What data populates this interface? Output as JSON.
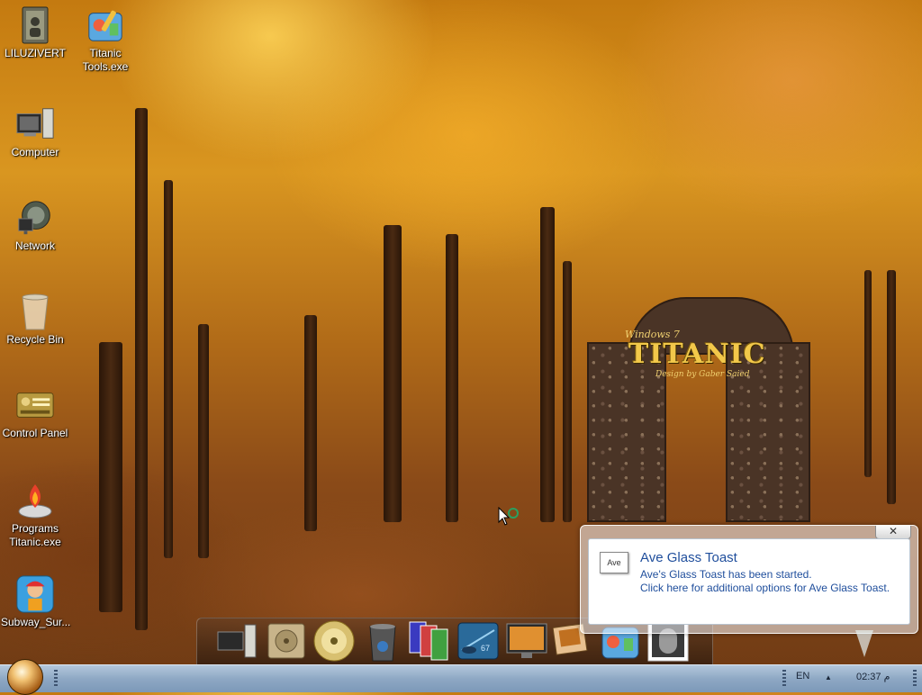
{
  "wallpaper": {
    "logo_small": "Windows 7",
    "logo_big": "TITANIC",
    "logo_sub": "Design by Gaber Saied"
  },
  "desktop_icons": [
    {
      "label": "LILUZIVERT",
      "icon": "user-folder-icon"
    },
    {
      "label": "Titanic\nTools.exe",
      "icon": "tools-icon"
    },
    {
      "label": "Computer",
      "icon": "computer-icon"
    },
    {
      "label": "Network",
      "icon": "network-icon"
    },
    {
      "label": "Recycle Bin",
      "icon": "recycle-bin-icon"
    },
    {
      "label": "Control Panel",
      "icon": "control-panel-icon"
    },
    {
      "label": "Programs\nTitanic.exe",
      "icon": "programs-icon"
    },
    {
      "label": "Subway_Sur...",
      "icon": "subway-surfers-icon"
    }
  ],
  "dock": {
    "items": [
      "computer-icon",
      "drive-icon",
      "disc-icon",
      "trash-icon",
      "pictures-icon",
      "gauge-icon",
      "monitor-icon",
      "photos-icon",
      "tools-icon",
      "mirror-icon"
    ],
    "gauge_value": "67"
  },
  "toast": {
    "close": "✕",
    "icon_text": "Ave",
    "title": "Ave Glass Toast",
    "line1": "Ave's Glass Toast has been started.",
    "line2": "Click here for additional options for Ave Glass Toast."
  },
  "taskbar": {
    "lang": "EN",
    "tray_arrow": "▲",
    "time": "02:37 م"
  }
}
